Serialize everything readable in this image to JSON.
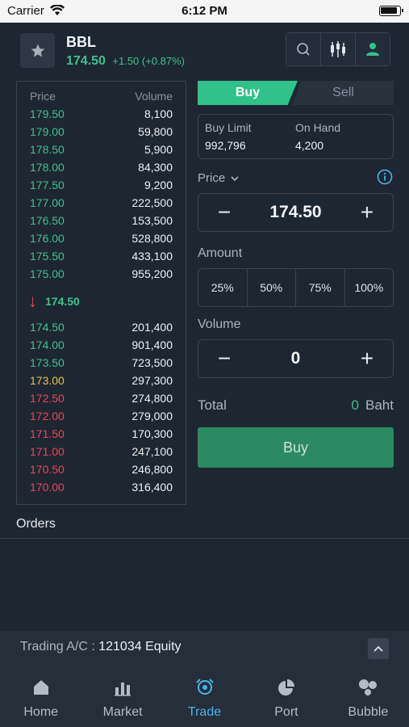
{
  "status_bar": {
    "carrier": "Carrier",
    "time": "6:12 PM"
  },
  "header": {
    "symbol": "BBL",
    "last_price": "174.50",
    "change": "+1.50 (+0.87%)",
    "icons": [
      "search-icon",
      "candlestick-icon",
      "user-icon"
    ]
  },
  "order_book": {
    "price_header": "Price",
    "volume_header": "Volume",
    "asks": [
      {
        "price": "179.50",
        "volume": "8,100",
        "color": "green"
      },
      {
        "price": "179.00",
        "volume": "59,800",
        "color": "green"
      },
      {
        "price": "178.50",
        "volume": "5,900",
        "color": "green"
      },
      {
        "price": "178.00",
        "volume": "84,300",
        "color": "green"
      },
      {
        "price": "177.50",
        "volume": "9,200",
        "color": "green"
      },
      {
        "price": "177.00",
        "volume": "222,500",
        "color": "green"
      },
      {
        "price": "176.50",
        "volume": "153,500",
        "color": "green"
      },
      {
        "price": "176.00",
        "volume": "528,800",
        "color": "green"
      },
      {
        "price": "175.50",
        "volume": "433,100",
        "color": "green"
      },
      {
        "price": "175.00",
        "volume": "955,200",
        "color": "green"
      }
    ],
    "last": "174.50",
    "bids": [
      {
        "price": "174.50",
        "volume": "201,400",
        "color": "green"
      },
      {
        "price": "174.00",
        "volume": "901,400",
        "color": "green"
      },
      {
        "price": "173.50",
        "volume": "723,500",
        "color": "green"
      },
      {
        "price": "173.00",
        "volume": "297,300",
        "color": "yellow"
      },
      {
        "price": "172.50",
        "volume": "274,800",
        "color": "red"
      },
      {
        "price": "172.00",
        "volume": "279,000",
        "color": "red"
      },
      {
        "price": "171.50",
        "volume": "170,300",
        "color": "red"
      },
      {
        "price": "171.00",
        "volume": "247,100",
        "color": "red"
      },
      {
        "price": "170.50",
        "volume": "246,800",
        "color": "red"
      },
      {
        "price": "170.00",
        "volume": "316,400",
        "color": "red"
      }
    ]
  },
  "order_form": {
    "buy_tab": "Buy",
    "sell_tab": "Sell",
    "buy_limit_label": "Buy Limit",
    "buy_limit_value": "992,796",
    "on_hand_label": "On Hand",
    "on_hand_value": "4,200",
    "price_label": "Price",
    "price_value": "174.50",
    "amount_label": "Amount",
    "amount_options": [
      "25%",
      "50%",
      "75%",
      "100%"
    ],
    "volume_label": "Volume",
    "volume_value": "0",
    "total_label": "Total",
    "total_value": "0",
    "total_unit": "Baht",
    "submit_label": "Buy"
  },
  "orders": {
    "label": "Orders"
  },
  "account": {
    "label": "Trading A/C :",
    "value": "121034 Equity"
  },
  "tabbar": {
    "items": [
      {
        "label": "Home",
        "icon": "home-icon"
      },
      {
        "label": "Market",
        "icon": "bar-chart-icon"
      },
      {
        "label": "Trade",
        "icon": "trade-icon",
        "active": true
      },
      {
        "label": "Port",
        "icon": "pie-chart-icon"
      },
      {
        "label": "Bubble",
        "icon": "bubble-icon"
      }
    ]
  },
  "colors": {
    "green": "#3fc28c",
    "red": "#e8465a",
    "yellow": "#e8c04a",
    "accent": "#48b4ee",
    "buy": "#31c18a"
  }
}
